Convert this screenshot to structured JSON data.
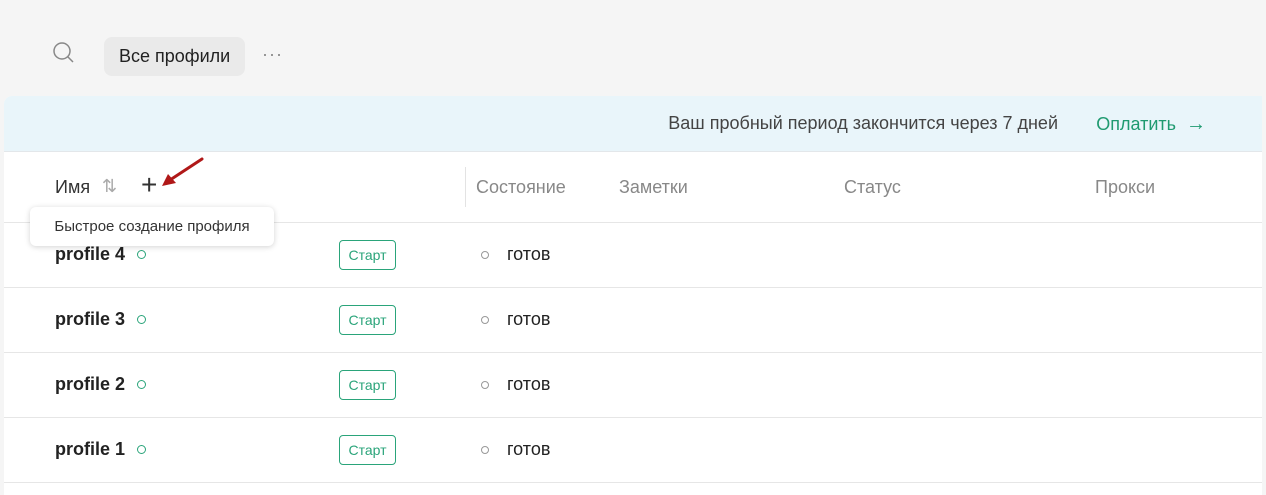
{
  "toolbar": {
    "search_icon": "search-icon",
    "filter_chip": "Все профили",
    "more": "···"
  },
  "banner": {
    "message": "Ваш пробный период закончится через 7 дней",
    "pay_label": "Оплатить",
    "pay_arrow": "→",
    "accent": "#1f9a70",
    "background": "#e9f5fa"
  },
  "table": {
    "columns": {
      "name": "Имя",
      "state": "Состояние",
      "notes": "Заметки",
      "status": "Статус",
      "proxy": "Прокси"
    },
    "sort_icon": "⇅",
    "add_icon": "+",
    "tooltip": "Быстрое создание профиля",
    "rows": [
      {
        "name": "profile 4",
        "button": "Старт",
        "state": "готов"
      },
      {
        "name": "profile 3",
        "button": "Старт",
        "state": "готов"
      },
      {
        "name": "profile 2",
        "button": "Старт",
        "state": "готов"
      },
      {
        "name": "profile 1",
        "button": "Старт",
        "state": "готов"
      }
    ]
  }
}
